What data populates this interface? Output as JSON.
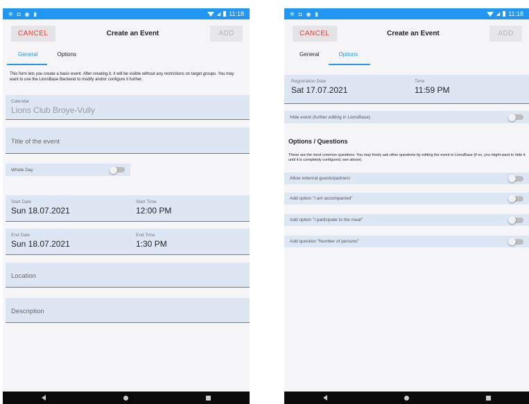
{
  "status": {
    "time": "11:18"
  },
  "screen1": {
    "cancel_label": "CANCEL",
    "title": "Create an Event",
    "add_label": "ADD",
    "tabs": [
      "General",
      "Options"
    ],
    "active_tab": "General",
    "intro": "This form lets you create a basic event. After creating it, it will be visible without any restrictions on target groups. You may want to use the LionsBase Backend to modify and/or configure it further.",
    "calendar": {
      "label": "Calendar",
      "value": "Lions Club Broye-Vully"
    },
    "title_field": {
      "placeholder": "Title of the event"
    },
    "whole_day": {
      "label": "Whole Day",
      "on": false
    },
    "start": {
      "date_label": "Start Date",
      "date": "Sun 18.07.2021",
      "time_label": "Start Time",
      "time": "12:00 PM"
    },
    "end": {
      "date_label": "End Date",
      "date": "Sun 18.07.2021",
      "time_label": "End Time",
      "time": "1:30 PM"
    },
    "location": {
      "placeholder": "Location"
    },
    "description": {
      "placeholder": "Description"
    }
  },
  "screen2": {
    "cancel_label": "CANCEL",
    "title": "Create an Event",
    "add_label": "ADD",
    "tabs": [
      "General",
      "Options"
    ],
    "active_tab": "Options",
    "registration": {
      "date_label": "Registration Date",
      "date": "Sat 17.07.2021",
      "time_label": "Time",
      "time": "11:59 PM"
    },
    "hide_event": {
      "label": "Hide event (further editing in LionsBase)",
      "on": false
    },
    "section_title": "Options / Questions",
    "section_text": "These are the most common questions. You may freely ask other questions by editing the event in LionsBase (if so, you might want to hide it until it is completely configured, see above).",
    "options": [
      {
        "label": "Allow external guests/partners",
        "on": false
      },
      {
        "label": "Add option \"I am accompanied\"",
        "on": false
      },
      {
        "label": "Add option \"I participate to the meal\"",
        "on": false
      },
      {
        "label": "Add question \"Number of persons\"",
        "on": false
      }
    ]
  }
}
